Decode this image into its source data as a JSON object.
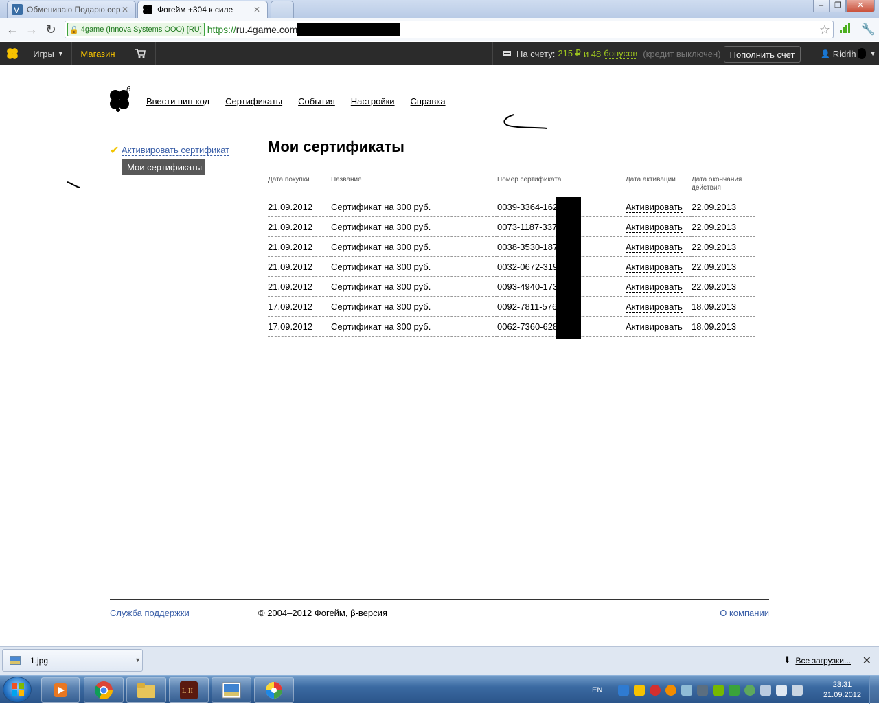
{
  "browser": {
    "tabs": [
      {
        "title": "Обмениваю Подарю серт",
        "active": false
      },
      {
        "title": "Фогейм +304 к силе",
        "active": true
      }
    ],
    "ev_badge": "4game (Innova Systems OOO) [RU]",
    "url_scheme": "https://",
    "url_host": "ru.4game.com"
  },
  "sitebar": {
    "games_label": "Игры",
    "shop_label": "Магазин",
    "account_label": "На счету:",
    "balance": "215 ₽",
    "and_label": "и 48",
    "bonus_label": "бонусов",
    "credit_label": "(кредит выключен)",
    "topup_label": "Пополнить счет",
    "username": "Ridrih"
  },
  "topnav": {
    "pin": "Ввести пин-код",
    "certificates": "Сертификаты",
    "events": "События",
    "settings": "Настройки",
    "help": "Справка",
    "beta": "β"
  },
  "sidemenu": {
    "activate": "Активировать сертификат",
    "my_certs": "Мои сертификаты"
  },
  "page_title": "Мои сертификаты",
  "table": {
    "headers": {
      "date": "Дата покупки",
      "name": "Название",
      "number": "Номер сертификата",
      "activation": "Дата активации",
      "expiry": "Дата окончания действия"
    },
    "rows": [
      {
        "date": "21.09.2012",
        "name": "Сертификат на 300 руб.",
        "number": "0039-3364-162",
        "activation": "Активировать",
        "expiry": "22.09.2013"
      },
      {
        "date": "21.09.2012",
        "name": "Сертификат на 300 руб.",
        "number": "0073-1187-337",
        "activation": "Активировать",
        "expiry": "22.09.2013"
      },
      {
        "date": "21.09.2012",
        "name": "Сертификат на 300 руб.",
        "number": "0038-3530-187",
        "activation": "Активировать",
        "expiry": "22.09.2013"
      },
      {
        "date": "21.09.2012",
        "name": "Сертификат на 300 руб.",
        "number": "0032-0672-319",
        "activation": "Активировать",
        "expiry": "22.09.2013"
      },
      {
        "date": "21.09.2012",
        "name": "Сертификат на 300 руб.",
        "number": "0093-4940-173",
        "activation": "Активировать",
        "expiry": "22.09.2013"
      },
      {
        "date": "17.09.2012",
        "name": "Сертификат на 300 руб.",
        "number": "0092-7811-576",
        "activation": "Активировать",
        "expiry": "18.09.2013"
      },
      {
        "date": "17.09.2012",
        "name": "Сертификат на 300 руб.",
        "number": "0062-7360-628",
        "activation": "Активировать",
        "expiry": "18.09.2013"
      }
    ]
  },
  "footer": {
    "support": "Служба поддержки",
    "copyright": "© 2004–2012 Фогейм, β-версия",
    "about": "О компании"
  },
  "download_shelf": {
    "file": "1.jpg",
    "all_downloads": "Все загрузки..."
  },
  "taskbar": {
    "lang": "EN",
    "time": "23:31",
    "date": "21.09.2012"
  },
  "colors": {
    "accent_yellow": "#f6c200",
    "bonus_green": "#9cc31f",
    "link_blue": "#3a5fa8",
    "header_dark": "#2b2b2b"
  }
}
